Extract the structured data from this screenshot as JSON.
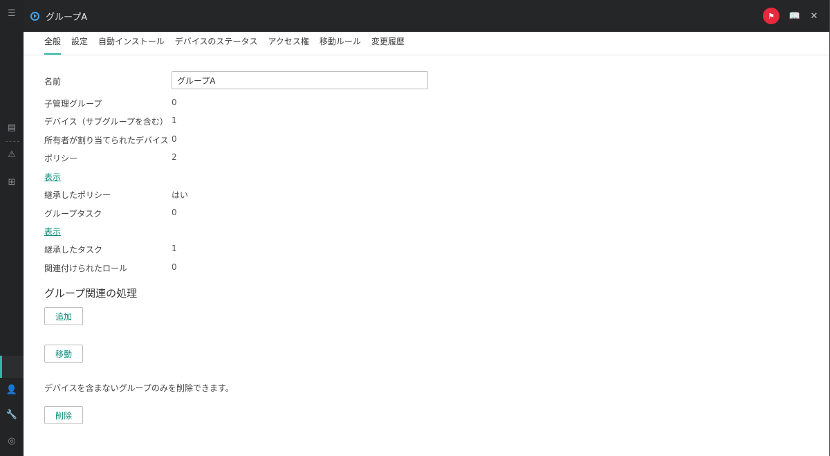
{
  "window": {
    "title": "グループA"
  },
  "tabs": [
    {
      "label": "全般"
    },
    {
      "label": "設定"
    },
    {
      "label": "自動インストール"
    },
    {
      "label": "デバイスのステータス"
    },
    {
      "label": "アクセス権"
    },
    {
      "label": "移動ルール"
    },
    {
      "label": "変更履歴"
    }
  ],
  "form": {
    "name_label": "名前",
    "name_value": "グループA",
    "fields": [
      {
        "label": "子管理グループ",
        "value": "0"
      },
      {
        "label": "デバイス（サブグループを含む）",
        "value": "1"
      },
      {
        "label": "所有者が割り当てられたデバイス",
        "value": "0"
      },
      {
        "label": "ポリシー",
        "value": "2"
      },
      {
        "label": "継承したポリシー",
        "value": "はい"
      },
      {
        "label": "グループタスク",
        "value": "0"
      },
      {
        "label": "継承したタスク",
        "value": "1"
      },
      {
        "label": "関連付けられたロール",
        "value": "0"
      }
    ],
    "show_policies_link": "表示",
    "show_tasks_link": "表示"
  },
  "actions": {
    "title": "グループ関連の処理",
    "add_label": "追加",
    "move_label": "移動",
    "delete_note": "デバイスを含まないグループのみを削除できます。",
    "delete_label": "削除"
  },
  "icons": {
    "menu": "menu-icon",
    "flag": "flag-icon",
    "book": "book-icon",
    "close": "close-icon"
  },
  "colors": {
    "accent": "#2fb7a6",
    "link": "#0a8a7a",
    "flag": "#e8283c",
    "titlebar": "#242627"
  }
}
